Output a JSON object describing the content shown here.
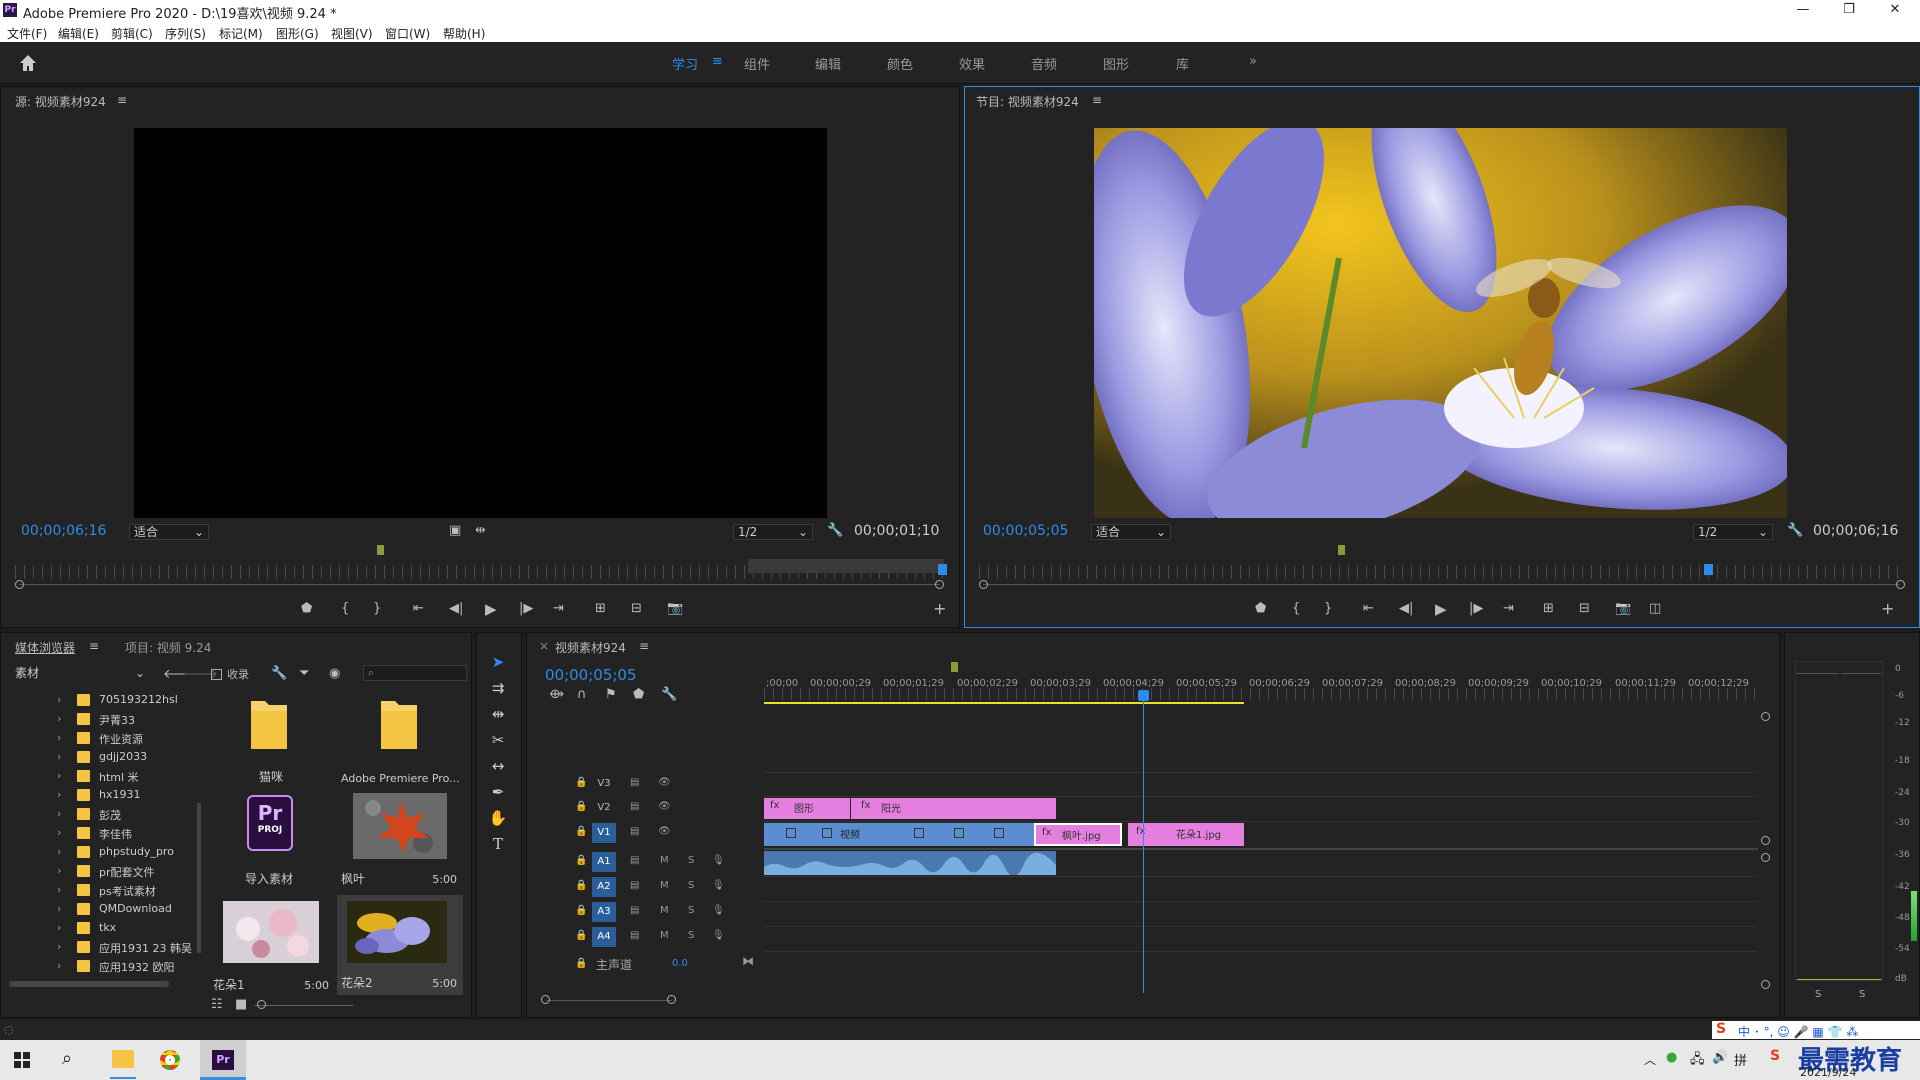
{
  "title": "Adobe Premiere Pro 2020 - D:\\19喜欢\\视频 9.24 *",
  "menu": [
    "文件(F)",
    "编辑(E)",
    "剪辑(C)",
    "序列(S)",
    "标记(M)",
    "图形(G)",
    "视图(V)",
    "窗口(W)",
    "帮助(H)"
  ],
  "workspaces": [
    "学习",
    "组件",
    "编辑",
    "颜色",
    "效果",
    "音频",
    "图形",
    "库"
  ],
  "active_workspace": "学习",
  "overflow": "»",
  "source": {
    "title": "源: 视频素材924",
    "timecode": "00;00;06;16",
    "fit": "适合",
    "resolution": "1/2",
    "duration": "00;00;01;10"
  },
  "program": {
    "title": "节目: 视频素材924",
    "timecode": "00;00;05;05",
    "fit": "适合",
    "resolution": "1/2",
    "duration": "00;00;06;16"
  },
  "media": {
    "tab1": "媒体浏览器",
    "tab2": "项目: 视频 9.24",
    "location": "素材",
    "collect": "收录",
    "folders": [
      "705193212hsl",
      "尹菁33",
      "作业资源",
      "gdjj2033",
      "html 米",
      "hx1931",
      "彭茂",
      "李佳伟",
      "phpstudy_pro",
      "pr配套文件",
      "ps考试素材",
      "QMDownload",
      "tkx",
      "应用1931 23 韩吴",
      "应用1932 欧阳"
    ],
    "thumbs": [
      {
        "name": "猫咪",
        "dur": ""
      },
      {
        "name": "Adobe Premiere Pro...",
        "dur": ""
      },
      {
        "name": "导入素材",
        "dur": ""
      },
      {
        "name": "枫叶",
        "dur": "5:00"
      },
      {
        "name": "花朵1",
        "dur": "5:00"
      },
      {
        "name": "花朵2",
        "dur": "5:00"
      }
    ]
  },
  "timeline": {
    "title": "视频素材924",
    "timecode": "00;00;05;05",
    "ticks": [
      ";00;00",
      "00;00;00;29",
      "00;00;01;29",
      "00;00;02;29",
      "00;00;03;29",
      "00;00;04;29",
      "00;00;05;29",
      "00;00;06;29",
      "00;00;07;29",
      "00;00;08;29",
      "00;00;09;29",
      "00;00;10;29",
      "00;00;11;29",
      "00;00;12;29"
    ],
    "video_tracks": [
      "V3",
      "V2",
      "V1"
    ],
    "audio_tracks": [
      "A1",
      "A2",
      "A3",
      "A4"
    ],
    "master": "主声道",
    "master_val": "0.0",
    "clips": {
      "v2a": "图形",
      "v2b": "阳光",
      "v1a": "视频",
      "v1b": "枫叶.jpg",
      "v1c": "花朵1.jpg"
    }
  },
  "meter": {
    "labels": [
      "0",
      "-6",
      "-12",
      "-18",
      "-24",
      "-30",
      "-36",
      "-42",
      "-48",
      "-54",
      "dB"
    ],
    "solo": [
      "S",
      "S"
    ]
  },
  "taskbar": {
    "date": "2021/9/24",
    "watermark": "最需教育"
  }
}
